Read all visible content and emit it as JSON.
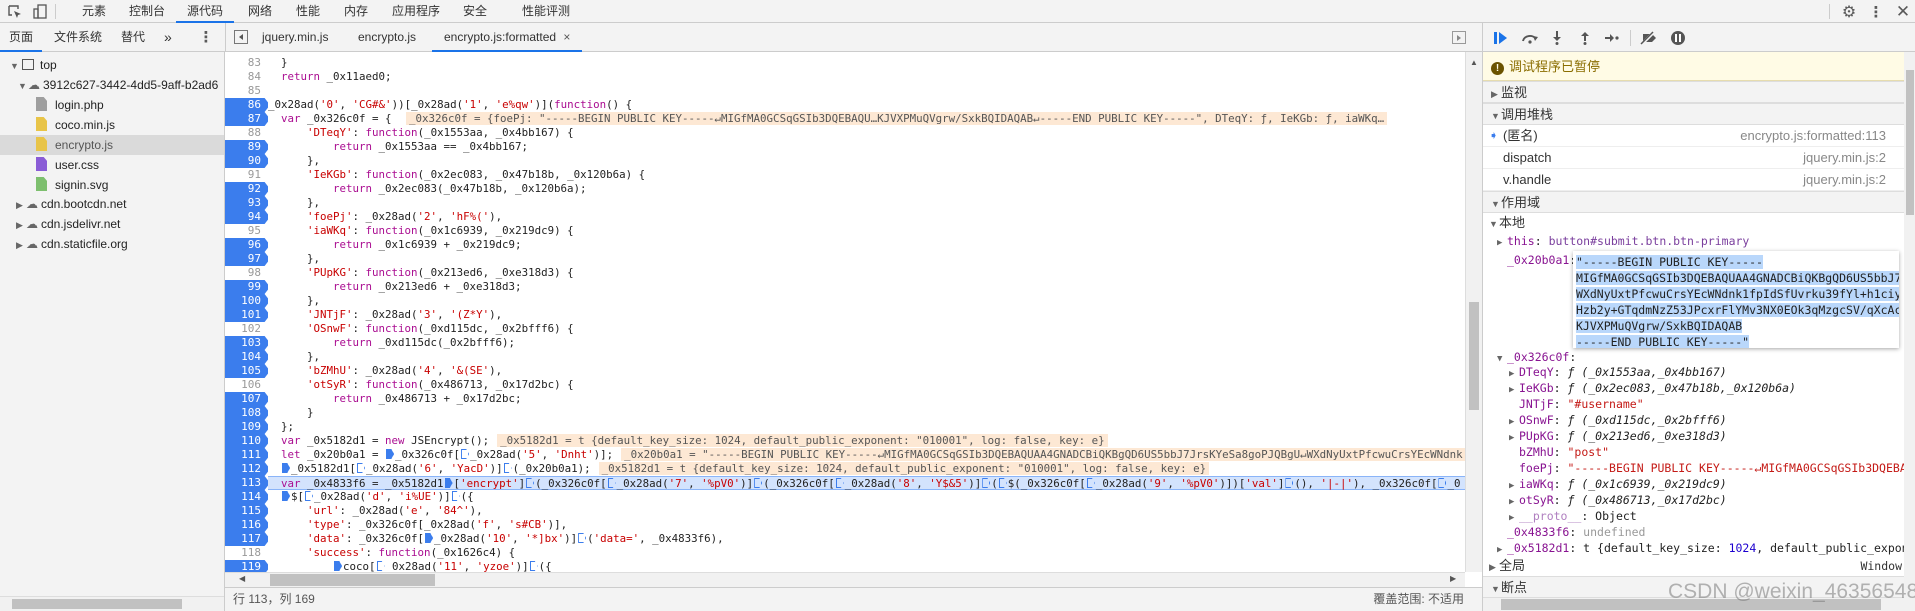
{
  "panel_tabs": [
    "元素",
    "控制台",
    "源代码",
    "网络",
    "性能",
    "内存",
    "应用程序",
    "安全",
    "性能评测"
  ],
  "active_panel_tab": "源代码",
  "navigator": {
    "tabs": [
      "页面",
      "文件系统",
      "替代"
    ],
    "more": "»",
    "tree": {
      "top": "top",
      "origin": "3912c627-3442-4dd5-9aff-b2ad6",
      "files": [
        {
          "name": "login.php",
          "color": "#9e9e9e"
        },
        {
          "name": "coco.min.js",
          "color": "#e8c448"
        },
        {
          "name": "encrypto.js",
          "color": "#e8c448",
          "selected": true
        },
        {
          "name": "user.css",
          "color": "#8a5cd6"
        },
        {
          "name": "signin.svg",
          "color": "#7dbf6e"
        }
      ],
      "domains": [
        "cdn.bootcdn.net",
        "cdn.jsdelivr.net",
        "cdn.staticfile.org"
      ]
    }
  },
  "editor": {
    "tabs": [
      {
        "label": "jquery.min.js"
      },
      {
        "label": "encrypto.js"
      },
      {
        "label": "encrypto.js:formatted",
        "active": true,
        "closable": true
      }
    ],
    "close_glyph": "×",
    "lines": [
      {
        "n": 83,
        "bp": false,
        "text": "  }"
      },
      {
        "n": 84,
        "bp": false,
        "text": "  return _0x11aed0;"
      },
      {
        "n": 85,
        "bp": false,
        "text": ""
      },
      {
        "n": 86,
        "bp": true,
        "text": "_0x28ad('0', 'CG#&'))[_0x28ad('1', 'e%qw')](function() {"
      },
      {
        "n": 87,
        "bp": true,
        "text": "  var _0x326c0f = { ",
        "inline": "_0x326c0f = {foePj: \"-----BEGIN PUBLIC KEY-----↵MIGfMA0GCSqGSIb3DQEBAQU…KJVXPMuQVgrw/SxkBQIDAQAB↵-----END PUBLIC KEY-----\", DTeqY: ƒ, IeKGb: ƒ, iaWKq…"
      },
      {
        "n": 88,
        "bp": false,
        "text": "      'DTeqY': function(_0x1553aa, _0x4bb167) {"
      },
      {
        "n": 89,
        "bp": true,
        "text": "          return _0x1553aa == _0x4bb167;"
      },
      {
        "n": 90,
        "bp": true,
        "text": "      },"
      },
      {
        "n": 91,
        "bp": false,
        "text": "      'IeKGb': function(_0x2ec083, _0x47b18b, _0x120b6a) {"
      },
      {
        "n": 92,
        "bp": true,
        "text": "          return _0x2ec083(_0x47b18b, _0x120b6a);"
      },
      {
        "n": 93,
        "bp": true,
        "text": "      },"
      },
      {
        "n": 94,
        "bp": true,
        "text": "      'foePj': _0x28ad('2', 'hF%('),"
      },
      {
        "n": 95,
        "bp": false,
        "text": "      'iaWKq': function(_0x1c6939, _0x219dc9) {"
      },
      {
        "n": 96,
        "bp": true,
        "text": "          return _0x1c6939 + _0x219dc9;"
      },
      {
        "n": 97,
        "bp": true,
        "text": "      },"
      },
      {
        "n": 98,
        "bp": false,
        "text": "      'PUpKG': function(_0x213ed6, _0xe318d3) {"
      },
      {
        "n": 99,
        "bp": true,
        "text": "          return _0x213ed6 + _0xe318d3;"
      },
      {
        "n": 100,
        "bp": true,
        "text": "      },"
      },
      {
        "n": 101,
        "bp": true,
        "text": "      'JNTjF': _0x28ad('3', '(Z*Y'),"
      },
      {
        "n": 102,
        "bp": false,
        "text": "      'OSnwF': function(_0xd115dc, _0x2bfff6) {"
      },
      {
        "n": 103,
        "bp": true,
        "text": "          return _0xd115dc(_0x2bfff6);"
      },
      {
        "n": 104,
        "bp": true,
        "text": "      },"
      },
      {
        "n": 105,
        "bp": true,
        "text": "      'bZMhU': _0x28ad('4', '&(SE'),"
      },
      {
        "n": 106,
        "bp": false,
        "text": "      'otSyR': function(_0x486713, _0x17d2bc) {"
      },
      {
        "n": 107,
        "bp": true,
        "text": "          return _0x486713 + _0x17d2bc;"
      },
      {
        "n": 108,
        "bp": true,
        "text": "      }"
      },
      {
        "n": 109,
        "bp": true,
        "text": "  };"
      },
      {
        "n": 110,
        "bp": true,
        "text": "  var _0x5182d1 = new JSEncrypt();",
        "inline": "_0x5182d1 = t {default_key_size: 1024, default_public_exponent: \"010001\", log: false, key: e}"
      },
      {
        "n": 111,
        "bp": true,
        "text": "  let _0x20b0a1 = ▶_0x326c0f[▷_0x28ad('5', 'Dnht')];",
        "inline": "_0x20b0a1 = \"-----BEGIN PUBLIC KEY-----↵MIGfMA0GCSqGSIb3DQEBAQUAA4GNADCBiQKBgQD6US5bbJ7JrsKYeSa8goPJQBgU↵WXdNyUxtPfcwuCrsYEcWNdnk"
      },
      {
        "n": 112,
        "bp": true,
        "text": "  ▶_0x5182d1[▷_0x28ad('6', 'YacD')]▷(_0x20b0a1);",
        "inline": "_0x5182d1 = t {default_key_size: 1024, default_public_exponent: \"010001\", log: false, key: e}"
      },
      {
        "n": 113,
        "bp": true,
        "exec": true,
        "text": "  var _0x4833f6 = _0x5182d1▶['encrypt']▷(_0x326c0f[▷_0x28ad('7', '%pV0')]▷(_0x326c0f[▷_0x28ad('8', 'Y$&5')]▷(▷$(_0x326c0f[▷_0x28ad('9', '%pV0')])['val']▷(), '|-|'), _0x326c0f[▷_0"
      },
      {
        "n": 114,
        "bp": true,
        "text": "  ▶$[▷_0x28ad('d', 'i%UE')]▷({"
      },
      {
        "n": 115,
        "bp": true,
        "text": "      'url': _0x28ad('e', '84^'),"
      },
      {
        "n": 116,
        "bp": true,
        "text": "      'type': _0x326c0f[_0x28ad('f', 's#CB')],"
      },
      {
        "n": 117,
        "bp": true,
        "text": "      'data': _0x326c0f[▶_0x28ad('10', '*]bx')]▷('data=', _0x4833f6),"
      },
      {
        "n": 118,
        "bp": false,
        "text": "      'success': function(_0x1626c4) {"
      },
      {
        "n": 119,
        "bp": true,
        "text": "          ▶coco[▷_0x28ad('11', 'yzoe')]▷({"
      },
      {
        "n": 120,
        "bp": false,
        "text": ""
      }
    ]
  },
  "status": {
    "position": "行 113，列 169",
    "coverage": "覆盖范围: 不适用"
  },
  "debugger": {
    "paused_message": "调试程序已暂停",
    "watch": "监视",
    "call_stack": "调用堆栈",
    "frames": [
      {
        "name": "(匿名)",
        "location": "encrypto.js:formatted:113",
        "current": true
      },
      {
        "name": "dispatch",
        "location": "jquery.min.js:2"
      },
      {
        "name": "v.handle",
        "location": "jquery.min.js:2"
      }
    ],
    "scope": "作用域",
    "local": "本地",
    "this_name": "this",
    "this_value": "button#submit.btn.btn-primary",
    "key_var": "_0x20b0a1",
    "key_popup": [
      "\"-----BEGIN PUBLIC KEY-----",
      "MIGfMA0GCSqGSIb3DQEBAQUAA4GNADCBiQKBgQD6US5bbJ7Jr",
      "WXdNyUxtPfcwuCrsYEcWNdnk1fpIdSfUvrku39fYl+h1ciyan",
      "Hzb2y+GTqdmNzZ53JPcxrFlYMv3NX0EOk3qMzgcSV/qXcAc+f",
      "KJVXPMuQVgrw/SxkBQIDAQAB",
      "-----END PUBLIC KEY-----\""
    ],
    "obj_name": "_0x326c0f",
    "obj_props": [
      {
        "name": "DTeqY",
        "value": "ƒ (_0x1553aa,_0x4bb167)",
        "kind": "fn",
        "expandable": true
      },
      {
        "name": "IeKGb",
        "value": "ƒ (_0x2ec083,_0x47b18b,_0x120b6a)",
        "kind": "fn",
        "expandable": true
      },
      {
        "name": "JNTjF",
        "value": "\"#username\"",
        "kind": "str"
      },
      {
        "name": "OSnwF",
        "value": "ƒ (_0xd115dc,_0x2bfff6)",
        "kind": "fn",
        "expandable": true
      },
      {
        "name": "PUpKG",
        "value": "ƒ (_0x213ed6,_0xe318d3)",
        "kind": "fn",
        "expandable": true
      },
      {
        "name": "bZMhU",
        "value": "\"post\"",
        "kind": "str"
      },
      {
        "name": "foePj",
        "value": "\"-----BEGIN PUBLIC KEY-----↵MIGfMA0GCSqGSIb3DQEBAQ…",
        "kind": "str"
      },
      {
        "name": "iaWKq",
        "value": "ƒ (_0x1c6939,_0x219dc9)",
        "kind": "fn",
        "expandable": true
      },
      {
        "name": "otSyR",
        "value": "ƒ (_0x486713,_0x17d2bc)",
        "kind": "fn",
        "expandable": true
      },
      {
        "name": "__proto__",
        "value": "Object",
        "kind": "proto",
        "expandable": true
      }
    ],
    "undef_name": "_0x4833f6",
    "undef_value": "undefined",
    "enc_name": "_0x5182d1",
    "enc_value_prefix": "t {default_key_size: ",
    "enc_value_num": "1024",
    "enc_value_suffix": ", default_public_expone…",
    "global": "全局",
    "global_value": "Window",
    "breakpoints": "断点"
  },
  "watermark": "CSDN @weixin_46356548",
  "colors": {
    "accent": "#1a73e8",
    "breakpoint": "#3b7ded",
    "inline_value_bg": "#fde8d4",
    "exec_line_bg": "#d3e3fd",
    "paused_banner_bg": "#fffbe5"
  }
}
